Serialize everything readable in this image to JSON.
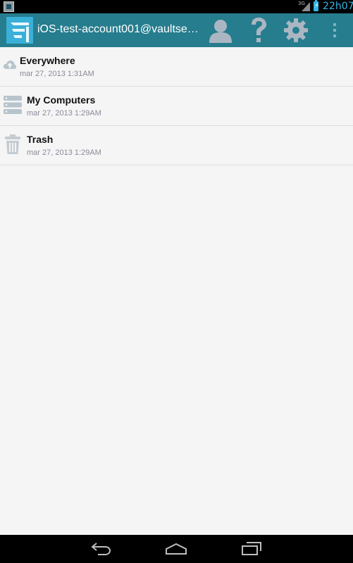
{
  "status_bar": {
    "network_type": "3G",
    "time": "22h07"
  },
  "action_bar": {
    "account_title": "iOS-test-account001@vaultser…",
    "icons": [
      "app-logo",
      "account-icon",
      "help-icon",
      "settings-icon",
      "overflow-menu-icon"
    ]
  },
  "list": {
    "items": [
      {
        "icon": "cloud-icon",
        "title": "Everywhere",
        "date": "mar 27, 2013 1:31AM"
      },
      {
        "icon": "server-icon",
        "title": "My Computers",
        "date": "mar 27, 2013 1:29AM"
      },
      {
        "icon": "trash-icon",
        "title": "Trash",
        "date": "mar 27, 2013 1:29AM"
      }
    ]
  },
  "nav_bar": {
    "icons": [
      "back-icon",
      "home-icon",
      "recents-icon"
    ]
  },
  "colors": {
    "action_bar": "#267d8e",
    "status_accent": "#33b5e5",
    "list_background": "#f5f5f5",
    "icon_gray": "#b8c4cc"
  }
}
